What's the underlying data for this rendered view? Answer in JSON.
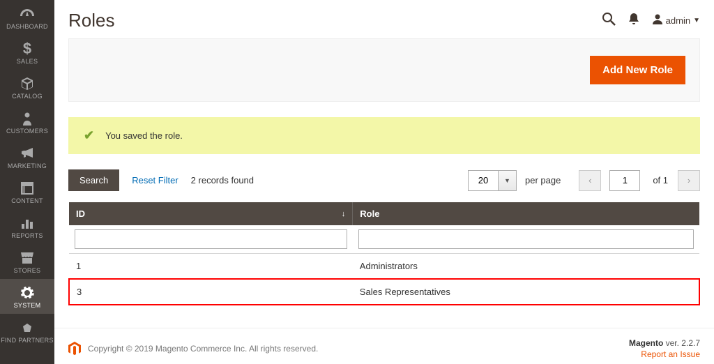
{
  "sidebar": {
    "items": [
      {
        "label": "DASHBOARD",
        "icon": "dashboard"
      },
      {
        "label": "SALES",
        "icon": "dollar"
      },
      {
        "label": "CATALOG",
        "icon": "cube"
      },
      {
        "label": "CUSTOMERS",
        "icon": "person"
      },
      {
        "label": "MARKETING",
        "icon": "megaphone"
      },
      {
        "label": "CONTENT",
        "icon": "layout"
      },
      {
        "label": "REPORTS",
        "icon": "bars"
      },
      {
        "label": "STORES",
        "icon": "storefront"
      },
      {
        "label": "SYSTEM",
        "icon": "gear"
      },
      {
        "label": "FIND PARTNERS",
        "icon": "partners"
      }
    ],
    "active_index": 8
  },
  "header": {
    "title": "Roles",
    "user": "admin"
  },
  "actions": {
    "add_new": "Add New Role"
  },
  "message": {
    "text": "You saved the role."
  },
  "filters": {
    "search": "Search",
    "reset": "Reset Filter",
    "records": "2 records found",
    "per_page_value": "20",
    "per_page_label": "per page",
    "page_current": "1",
    "page_of": "of 1"
  },
  "grid": {
    "columns": {
      "id": "ID",
      "role": "Role"
    },
    "rows": [
      {
        "id": "1",
        "role": "Administrators"
      },
      {
        "id": "3",
        "role": "Sales Representatives"
      }
    ],
    "highlight_row": 1
  },
  "footer": {
    "copyright": "Copyright © 2019 Magento Commerce Inc. All rights reserved.",
    "product": "Magento",
    "version": " ver. 2.2.7",
    "report": "Report an Issue"
  }
}
